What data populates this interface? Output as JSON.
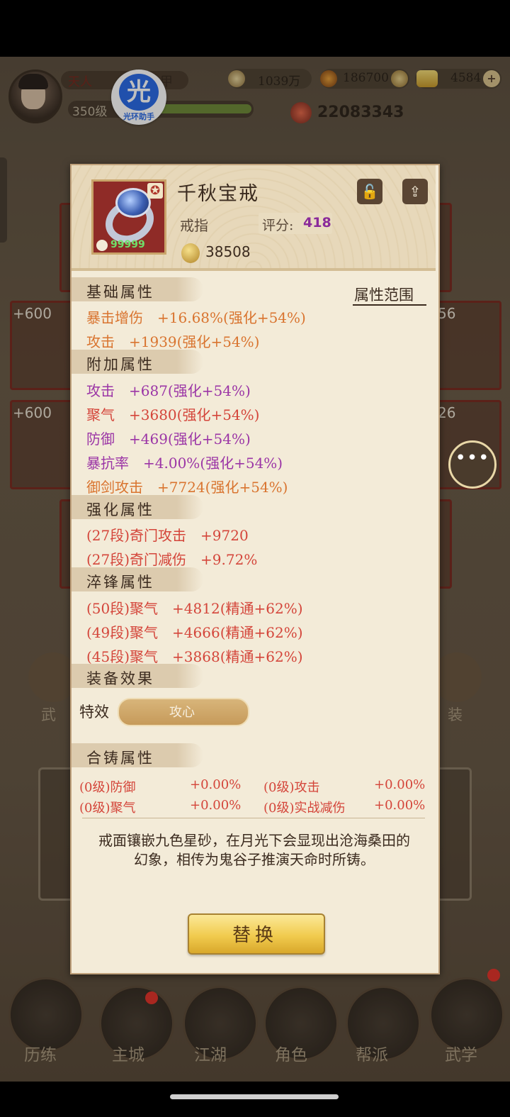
{
  "header": {
    "rank": "天人",
    "rank_suffix": "甲",
    "level": "350级",
    "badge_main": "光",
    "badge_label": "光环助手",
    "currency": [
      {
        "icon": "silver-coin-icon",
        "value": "1039万"
      },
      {
        "icon": "gem-icon",
        "value": "186700"
      },
      {
        "icon": "gold-ingot-icon",
        "value": "4584"
      }
    ],
    "combat_power": "22083343"
  },
  "background": {
    "slots_left": [
      "+600",
      "+600"
    ],
    "slots_right": [
      "56",
      "26"
    ],
    "side_labels": [
      "武",
      "装"
    ],
    "nav_tabs": [
      "历练",
      "主城",
      "江湖",
      "角色",
      "帮派",
      "武学"
    ]
  },
  "item": {
    "name": "千秋宝戒",
    "type": "戒指",
    "score_label": "评分:",
    "score_value": "418",
    "level_badge": "99999",
    "coin_value": "38508",
    "lock_icon": "lock-icon",
    "share_icon": "share-icon"
  },
  "sections": {
    "base_title": "基础属性",
    "attr_range": "属性范围",
    "base": [
      {
        "text": "暴击增伤　+16.68%(强化+54%)",
        "color": "#d9742f"
      },
      {
        "text": "攻击　+1939(强化+54%)",
        "color": "#d9742f"
      }
    ],
    "extra_title": "附加属性",
    "extra": [
      {
        "text": "攻击　+687(强化+54%)",
        "color": "#9b35a6"
      },
      {
        "text": "聚气　+3680(强化+54%)",
        "color": "#d4453a"
      },
      {
        "text": "防御　+469(强化+54%)",
        "color": "#9b35a6"
      },
      {
        "text": "暴抗率　+4.00%(强化+54%)",
        "color": "#9b35a6"
      },
      {
        "text": "御剑攻击　+7724(强化+54%)",
        "color": "#d9742f"
      }
    ],
    "enhance_title": "强化属性",
    "enhance": [
      {
        "text": "(27段)奇门攻击　+9720",
        "color": "#d4453a"
      },
      {
        "text": "(27段)奇门减伤　+9.72%",
        "color": "#d4453a"
      }
    ],
    "temper_title": "淬锋属性",
    "temper": [
      {
        "text": "(50段)聚气　+4812(精通+62%)",
        "color": "#d4453a"
      },
      {
        "text": "(49段)聚气　+4666(精通+62%)",
        "color": "#d4453a"
      },
      {
        "text": "(45段)聚气　+3868(精通+62%)",
        "color": "#d4453a"
      }
    ],
    "effect_title": "装备效果",
    "effect_label": "特效",
    "effect_value": "攻心",
    "forge_title": "合铸属性",
    "forge": [
      {
        "name": "(0级)防御",
        "value": "+0.00%"
      },
      {
        "name": "(0级)攻击",
        "value": "+0.00%"
      },
      {
        "name": "(0级)聚气",
        "value": "+0.00%"
      },
      {
        "name": "(0级)实战减伤",
        "value": "+0.00%"
      }
    ],
    "description": "戒面镶嵌九色星砂，在月光下会显现出沧海桑田的幻象，相传为鬼谷子推演天命时所铸。"
  },
  "replace_button": "替换",
  "chat_icon": "chat-bubble-icon"
}
